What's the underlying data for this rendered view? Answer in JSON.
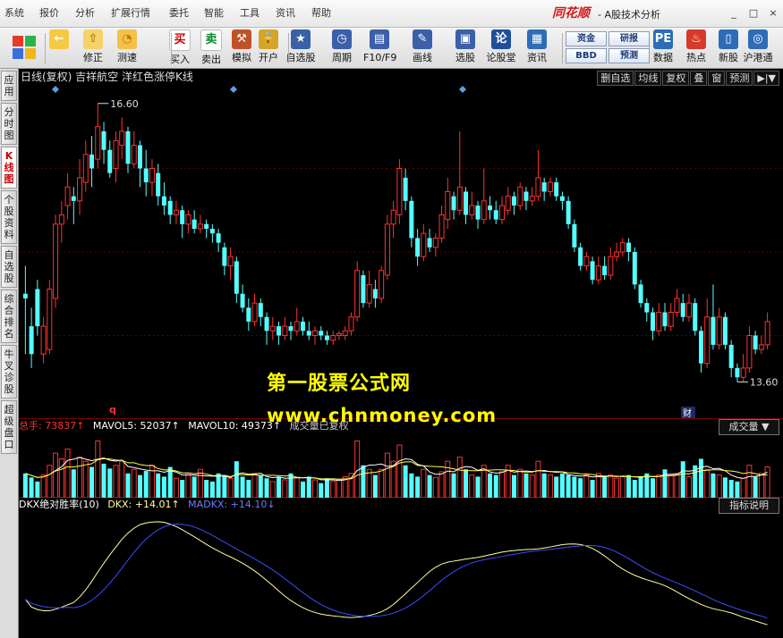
{
  "menu": [
    "系统",
    "报价",
    "分析",
    "扩展行情",
    "委托",
    "智能",
    "工具",
    "资讯",
    "帮助"
  ],
  "brand": {
    "name": "同花顺",
    "sub": "- A股技术分析"
  },
  "window_buttons": [
    "_",
    "□",
    "×"
  ],
  "toolbar": {
    "items": [
      {
        "name": "back-button",
        "label": "",
        "icon": "←"
      },
      {
        "name": "modify-button",
        "label": "修正",
        "icon": "⇧"
      },
      {
        "name": "test-button",
        "label": "测速",
        "icon": "◔"
      },
      {
        "name": "buy-button",
        "label": "买入",
        "icon": "买"
      },
      {
        "name": "sell-button",
        "label": "卖出",
        "icon": "卖"
      },
      {
        "name": "simulate-button",
        "label": "模拟",
        "icon": "⚒"
      },
      {
        "name": "open-account-button",
        "label": "开户",
        "icon": "🔒"
      },
      {
        "name": "watchlist-button",
        "label": "自选股",
        "icon": "★"
      },
      {
        "name": "period-button",
        "label": "周期",
        "icon": "◷"
      },
      {
        "name": "f10-button",
        "label": "F10/F9",
        "icon": "▤"
      },
      {
        "name": "draw-button",
        "label": "画线",
        "icon": "✎"
      },
      {
        "name": "stock-select-button",
        "label": "选股",
        "icon": "▣"
      },
      {
        "name": "forum-button",
        "label": "论股堂",
        "icon": "论"
      },
      {
        "name": "info-button",
        "label": "资讯",
        "icon": "▦"
      },
      {
        "name": "data-button",
        "label": "数据",
        "icon": "PE"
      },
      {
        "name": "hotspot-button",
        "label": "热点",
        "icon": "♨"
      },
      {
        "name": "new-stock-button",
        "label": "新股",
        "icon": "▯"
      },
      {
        "name": "hk-connect-button",
        "label": "沪港通",
        "icon": "◎"
      }
    ],
    "small_buttons": [
      {
        "name": "fund-button",
        "label": "资金"
      },
      {
        "name": "research-button",
        "label": "研报"
      },
      {
        "name": "bbd-button",
        "label": "BBD"
      },
      {
        "name": "forecast-button",
        "label": "预测"
      }
    ]
  },
  "sidebar": [
    "应用",
    "分时图",
    "K线图",
    "个股资料",
    "自选股",
    "综合排名",
    "牛叉诊股",
    "超级盘口"
  ],
  "chart_header": {
    "title": "日线(复权) 吉祥航空 洋红色涨停K线",
    "buttons": [
      "删自选",
      "均线",
      "复权",
      "叠",
      "窗",
      "预测",
      "▶|▼"
    ]
  },
  "watermark": {
    "line1": "第一股票公式网",
    "line2": "www.chnmoney.com"
  },
  "volume_header": {
    "total": "总手: 73837↑",
    "mavol5": "MAVOL5: 52037↑",
    "mavol10": "MAVOL10: 49373↑",
    "note": "成交量已复权",
    "dropdown": "成交量"
  },
  "indicator_header": {
    "title": "DKX绝对胜率(10)",
    "dkx": "DKX: +14.01↑",
    "madkx": "MADKX: +14.10↓",
    "explain": "指标说明"
  },
  "annotations": {
    "high": "16.60",
    "low": "13.60",
    "q_marker": "q",
    "cai_marker": "财"
  },
  "colors": {
    "up": "#ff3232",
    "down": "#54ffff",
    "dkx": "#ffffa0",
    "madkx": "#3b4cff",
    "ma5": "#ffffff",
    "ma10": "#ffff55"
  },
  "chart_data": [
    {
      "type": "candlestick",
      "title": "日线(复权) 吉祥航空 洋红色涨停K线",
      "ylim": [
        13.2,
        16.8
      ],
      "candles": [
        [
          14.55,
          14.5,
          14.85,
          13.9
        ],
        [
          14.2,
          13.9,
          14.4,
          13.75
        ],
        [
          14.6,
          14.2,
          14.7,
          14.1
        ],
        [
          13.9,
          14.2,
          14.3,
          13.8
        ],
        [
          13.95,
          14.6,
          14.7,
          13.9
        ],
        [
          14.5,
          15.3,
          15.4,
          14.4
        ],
        [
          15.3,
          15.4,
          15.55,
          15.1
        ],
        [
          15.5,
          15.7,
          15.85,
          15.35
        ],
        [
          15.6,
          15.55,
          15.7,
          15.3
        ],
        [
          15.55,
          15.8,
          16.0,
          15.4
        ],
        [
          15.75,
          16.05,
          16.2,
          15.65
        ],
        [
          16.05,
          15.9,
          16.25,
          15.7
        ],
        [
          16.0,
          16.35,
          16.6,
          15.9
        ],
        [
          16.3,
          16.1,
          16.4,
          15.95
        ],
        [
          16.1,
          15.85,
          16.2,
          15.8
        ],
        [
          15.9,
          16.2,
          16.3,
          15.75
        ],
        [
          16.15,
          16.3,
          16.45,
          16.0
        ],
        [
          16.3,
          15.95,
          16.35,
          15.85
        ],
        [
          15.95,
          16.15,
          16.3,
          15.9
        ],
        [
          16.15,
          15.9,
          16.2,
          15.7
        ],
        [
          15.9,
          15.75,
          16.1,
          15.6
        ],
        [
          15.75,
          15.9,
          16.0,
          15.6
        ],
        [
          15.85,
          15.6,
          15.95,
          15.5
        ],
        [
          15.6,
          15.5,
          15.75,
          15.4
        ],
        [
          15.55,
          15.4,
          15.6,
          15.3
        ],
        [
          15.4,
          15.45,
          15.55,
          15.3
        ],
        [
          15.45,
          15.3,
          15.5,
          15.15
        ],
        [
          15.3,
          15.4,
          15.45,
          15.2
        ],
        [
          15.35,
          15.25,
          15.45,
          15.2
        ],
        [
          15.25,
          15.3,
          15.4,
          15.2
        ],
        [
          15.3,
          15.25,
          15.35,
          15.15
        ],
        [
          15.25,
          15.2,
          15.3,
          15.1
        ],
        [
          15.2,
          15.1,
          15.25,
          15.0
        ],
        [
          15.05,
          14.85,
          15.1,
          14.75
        ],
        [
          14.85,
          14.95,
          15.05,
          14.7
        ],
        [
          14.9,
          14.55,
          14.95,
          14.45
        ],
        [
          14.55,
          14.4,
          14.65,
          14.35
        ],
        [
          14.4,
          14.25,
          14.5,
          14.15
        ],
        [
          14.25,
          14.45,
          14.55,
          14.2
        ],
        [
          14.45,
          14.3,
          14.5,
          14.2
        ],
        [
          14.3,
          14.15,
          14.35,
          14.0
        ],
        [
          14.15,
          14.2,
          14.3,
          14.05
        ],
        [
          14.2,
          14.1,
          14.25,
          14.0
        ],
        [
          14.1,
          14.2,
          14.3,
          14.05
        ],
        [
          14.2,
          14.15,
          14.25,
          14.05
        ],
        [
          14.15,
          14.25,
          14.4,
          14.1
        ],
        [
          14.25,
          14.15,
          14.3,
          14.1
        ],
        [
          14.15,
          14.1,
          14.25,
          14.05
        ],
        [
          14.1,
          14.15,
          14.2,
          14.0
        ],
        [
          14.15,
          14.1,
          14.2,
          14.05
        ],
        [
          14.1,
          14.05,
          14.15,
          14.0
        ],
        [
          14.05,
          14.1,
          14.15,
          14.0
        ],
        [
          14.1,
          14.12,
          14.15,
          14.05
        ],
        [
          14.1,
          14.15,
          14.2,
          14.05
        ],
        [
          14.15,
          14.3,
          14.35,
          14.1
        ],
        [
          14.3,
          14.8,
          14.9,
          14.25
        ],
        [
          14.75,
          14.45,
          14.8,
          14.4
        ],
        [
          14.45,
          14.65,
          14.8,
          14.4
        ],
        [
          14.6,
          14.5,
          14.7,
          14.4
        ],
        [
          14.5,
          14.8,
          14.85,
          14.45
        ],
        [
          14.75,
          15.3,
          15.4,
          14.7
        ],
        [
          15.3,
          15.45,
          15.55,
          15.15
        ],
        [
          15.4,
          15.9,
          16.0,
          15.3
        ],
        [
          15.8,
          15.55,
          15.9,
          15.45
        ],
        [
          15.55,
          15.15,
          15.6,
          15.05
        ],
        [
          15.15,
          14.95,
          15.25,
          14.85
        ],
        [
          14.95,
          15.2,
          15.3,
          14.9
        ],
        [
          15.15,
          15.05,
          15.25,
          15.0
        ],
        [
          15.05,
          15.15,
          15.2,
          14.95
        ],
        [
          15.15,
          15.4,
          15.5,
          15.1
        ],
        [
          15.35,
          15.65,
          15.8,
          15.25
        ],
        [
          15.6,
          15.45,
          15.65,
          15.35
        ],
        [
          15.45,
          15.7,
          16.3,
          15.4
        ],
        [
          15.65,
          15.4,
          15.7,
          15.3
        ],
        [
          15.4,
          15.5,
          15.65,
          15.35
        ],
        [
          15.5,
          15.35,
          15.55,
          15.25
        ],
        [
          15.35,
          15.55,
          15.9,
          15.3
        ],
        [
          15.5,
          15.45,
          15.6,
          15.35
        ],
        [
          15.45,
          15.35,
          15.55,
          15.3
        ],
        [
          15.35,
          15.5,
          15.6,
          15.3
        ],
        [
          15.45,
          15.6,
          15.7,
          15.4
        ],
        [
          15.6,
          15.5,
          15.65,
          15.4
        ],
        [
          15.5,
          15.7,
          15.75,
          15.45
        ],
        [
          15.65,
          15.55,
          15.7,
          15.45
        ],
        [
          15.55,
          15.6,
          15.7,
          15.5
        ],
        [
          15.6,
          15.8,
          16.1,
          15.55
        ],
        [
          15.75,
          15.65,
          15.8,
          15.55
        ],
        [
          15.65,
          15.75,
          15.8,
          15.6
        ],
        [
          15.75,
          15.6,
          15.8,
          15.55
        ],
        [
          15.6,
          15.55,
          15.65,
          15.45
        ],
        [
          15.55,
          15.3,
          15.6,
          15.25
        ],
        [
          15.3,
          15.05,
          15.35,
          15.0
        ],
        [
          15.05,
          14.85,
          15.1,
          14.8
        ],
        [
          14.85,
          14.95,
          15.0,
          14.8
        ],
        [
          14.9,
          14.7,
          14.95,
          14.65
        ],
        [
          14.7,
          14.85,
          14.95,
          14.65
        ],
        [
          14.85,
          14.75,
          14.95,
          14.7
        ],
        [
          14.75,
          14.95,
          15.05,
          14.7
        ],
        [
          14.95,
          15.0,
          15.1,
          14.9
        ],
        [
          15.0,
          15.1,
          15.15,
          14.95
        ],
        [
          15.1,
          15.0,
          15.15,
          14.9
        ],
        [
          15.0,
          14.65,
          15.05,
          14.6
        ],
        [
          14.65,
          14.45,
          14.7,
          14.4
        ],
        [
          14.45,
          14.35,
          14.5,
          14.25
        ],
        [
          14.35,
          14.15,
          14.4,
          14.05
        ],
        [
          14.15,
          14.35,
          14.45,
          14.1
        ],
        [
          14.35,
          14.2,
          14.45,
          14.15
        ],
        [
          14.2,
          14.35,
          14.45,
          14.15
        ],
        [
          14.35,
          14.5,
          14.6,
          14.3
        ],
        [
          14.45,
          14.3,
          14.55,
          14.25
        ],
        [
          14.3,
          14.45,
          14.55,
          14.25
        ],
        [
          14.45,
          14.15,
          14.5,
          14.1
        ],
        [
          14.15,
          13.8,
          14.2,
          13.7
        ],
        [
          13.8,
          14.3,
          14.5,
          13.75
        ],
        [
          14.3,
          14.0,
          14.65,
          13.95
        ],
        [
          14.0,
          14.3,
          14.4,
          13.95
        ],
        [
          14.3,
          14.0,
          14.35,
          13.95
        ],
        [
          14.0,
          13.75,
          14.05,
          13.65
        ],
        [
          13.75,
          13.65,
          13.8,
          13.6
        ],
        [
          13.65,
          13.75,
          13.9,
          13.6
        ],
        [
          13.75,
          14.1,
          14.2,
          13.7
        ],
        [
          14.1,
          13.95,
          14.15,
          13.9
        ],
        [
          13.95,
          14.0,
          14.1,
          13.9
        ],
        [
          14.0,
          14.25,
          14.35,
          13.95
        ]
      ]
    },
    {
      "type": "bar",
      "title": "成交量",
      "series": [
        {
          "name": "总手",
          "values": [
            30,
            25,
            20,
            28,
            40,
            55,
            48,
            60,
            35,
            50,
            45,
            38,
            70,
            42,
            36,
            40,
            45,
            30,
            35,
            28,
            33,
            40,
            30,
            26,
            38,
            24,
            22,
            30,
            26,
            35,
            22,
            20,
            30,
            28,
            24,
            45,
            26,
            22,
            30,
            28,
            24,
            20,
            26,
            22,
            30,
            25,
            20,
            26,
            22,
            18,
            24,
            20,
            22,
            26,
            30,
            70,
            40,
            35,
            28,
            35,
            55,
            45,
            65,
            40,
            30,
            26,
            35,
            28,
            25,
            32,
            45,
            30,
            50,
            35,
            28,
            26,
            40,
            30,
            28,
            32,
            40,
            28,
            35,
            30,
            28,
            45,
            30,
            28,
            26,
            30,
            28,
            26,
            24,
            28,
            22,
            30,
            26,
            28,
            24,
            26,
            28,
            22,
            26,
            30,
            24,
            28,
            35,
            28,
            30,
            45,
            26,
            40,
            48,
            35,
            30,
            28,
            25,
            22,
            20,
            24,
            40,
            26,
            30,
            38
          ]
        },
        {
          "name": "MAVOL5",
          "values": []
        },
        {
          "name": "MAVOL10",
          "values": []
        }
      ]
    },
    {
      "type": "line",
      "title": "DKX绝对胜率(10)",
      "series": [
        {
          "name": "DKX",
          "values": []
        },
        {
          "name": "MADKX",
          "values": []
        }
      ]
    }
  ]
}
